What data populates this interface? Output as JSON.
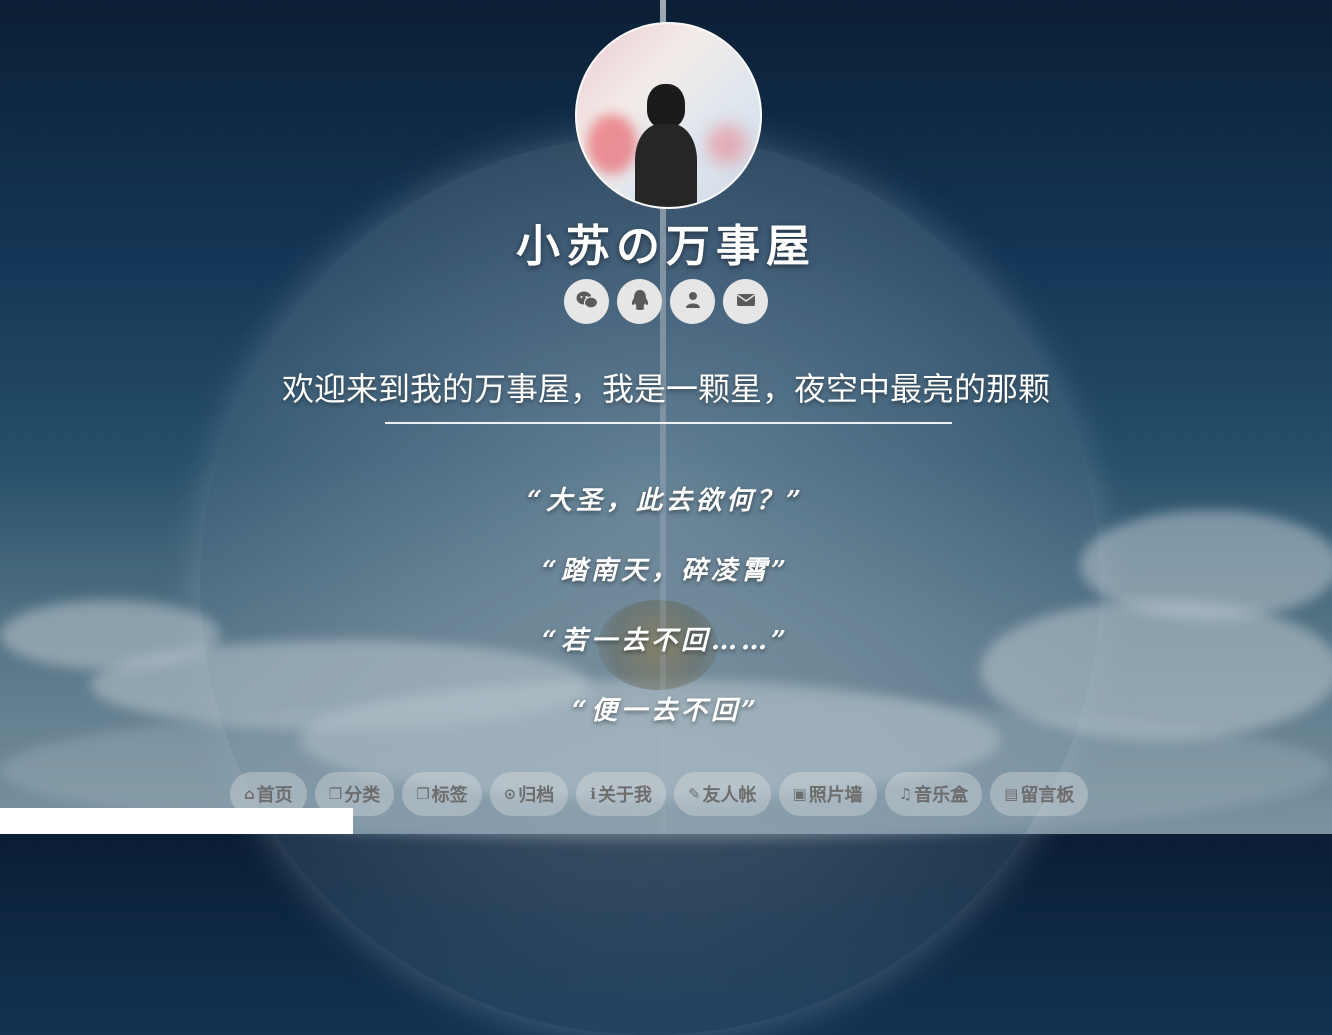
{
  "site": {
    "title": "小苏の万事屋",
    "tagline": "欢迎来到我的万事屋，我是一颗星，夜空中最亮的那颗"
  },
  "socials": [
    {
      "name": "wechat-icon",
      "glyph": "💬"
    },
    {
      "name": "qq-icon",
      "glyph": "🐧"
    },
    {
      "name": "user-icon",
      "glyph": "👤"
    },
    {
      "name": "mail-icon",
      "glyph": "✉"
    }
  ],
  "poem": [
    "“大圣，此去欲何？”",
    "“踏南天，碎凌霄”",
    "“若一去不回……”",
    "“便一去不回”"
  ],
  "nav": [
    {
      "icon": "home-icon",
      "glyph": "⌂",
      "label": "首页"
    },
    {
      "icon": "category-icon",
      "glyph": "❐",
      "label": "分类"
    },
    {
      "icon": "tag-icon",
      "glyph": "❐",
      "label": "标签"
    },
    {
      "icon": "archive-icon",
      "glyph": "⊙",
      "label": "归档"
    },
    {
      "icon": "info-icon",
      "glyph": "ℹ",
      "label": "关于我"
    },
    {
      "icon": "pencil-icon",
      "glyph": "✎",
      "label": "友人帐"
    },
    {
      "icon": "image-icon",
      "glyph": "▣",
      "label": "照片墙"
    },
    {
      "icon": "music-icon",
      "glyph": "♫",
      "label": "音乐盒"
    },
    {
      "icon": "book-icon",
      "glyph": "▤",
      "label": "留言板"
    }
  ]
}
